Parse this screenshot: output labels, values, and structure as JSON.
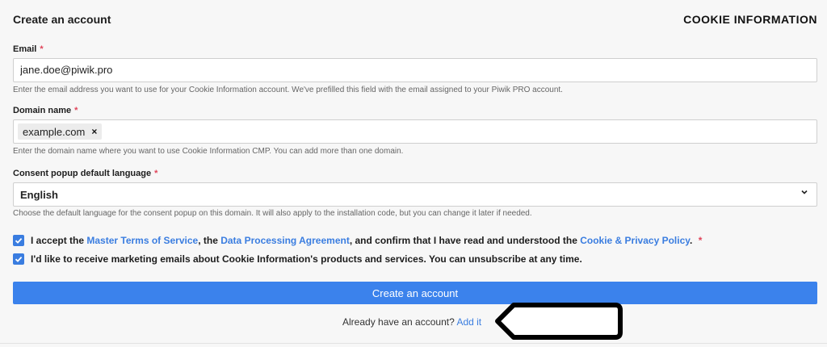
{
  "header": {
    "title": "Create an account",
    "brand": "COOKIE INFORMATION"
  },
  "form": {
    "required_marker": "*",
    "email": {
      "label": "Email",
      "value": "jane.doe@piwik.pro",
      "hint": "Enter the email address you want to use for your Cookie Information account. We've prefilled this field with the email assigned to your Piwik PRO account."
    },
    "domain": {
      "label": "Domain name",
      "chips": [
        "example.com"
      ],
      "remove_symbol": "×",
      "hint": "Enter the domain name where you want to use Cookie Information CMP. You can add more than one domain."
    },
    "language": {
      "label": "Consent popup default language",
      "selected": "English",
      "hint": "Choose the default language for the consent popup on this domain. It will also apply to the installation code, but you can change it later if needed."
    },
    "terms": {
      "checked": true,
      "text_1": "I accept the ",
      "link_1": "Master Terms of Service",
      "text_2": ", the ",
      "link_2": "Data Processing Agreement",
      "text_3": ", and confirm that I have read and understood the ",
      "link_3": "Cookie & Privacy Policy",
      "text_4": ". "
    },
    "marketing": {
      "checked": true,
      "text": "I'd like to receive marketing emails about Cookie Information's products and services. You can unsubscribe at any time."
    },
    "submit_label": "Create an account",
    "already_text": "Already have an account?",
    "add_link": "Add it"
  },
  "colors": {
    "accent": "#3b82ec",
    "required": "#e0455a",
    "background": "#f7f7f7"
  }
}
